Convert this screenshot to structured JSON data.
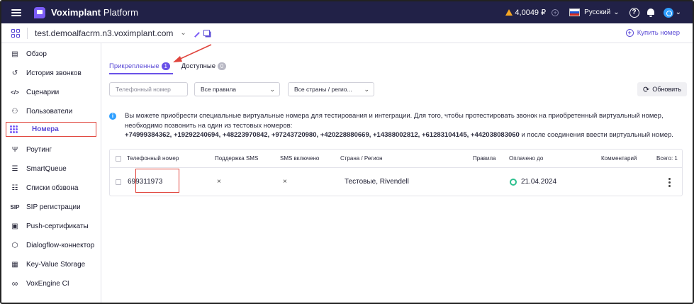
{
  "topbar": {
    "brand_bold": "Voximplant",
    "brand_light": "Platform",
    "balance": "4,0049 ₽",
    "language": "Русский",
    "help_glyph": "?",
    "menu_icon": "hamburger-icon",
    "logo_icon": "voximplant-logo-icon",
    "warning_icon": "warning-icon",
    "notifications_icon": "bell-icon",
    "user_icon": "power-icon"
  },
  "account": {
    "name": "test.demoalfacrm.n3.voximplant.com",
    "buy_label": "Купить номер"
  },
  "sidebar": {
    "items": [
      {
        "label": "Обзор",
        "icon": "dashboard-icon",
        "glyph": "▤"
      },
      {
        "label": "История звонков",
        "icon": "history-icon",
        "glyph": "↺"
      },
      {
        "label": "Сценарии",
        "icon": "code-icon",
        "glyph": "</>"
      },
      {
        "label": "Пользователи",
        "icon": "users-icon",
        "glyph": "⚇"
      },
      {
        "label": "Номера",
        "icon": "dialpad-icon",
        "glyph": "",
        "active": true
      },
      {
        "label": "Роутинг",
        "icon": "routing-icon",
        "glyph": "Ψ"
      },
      {
        "label": "SmartQueue",
        "icon": "queue-icon",
        "glyph": "☰"
      },
      {
        "label": "Списки обзвона",
        "icon": "list-icon",
        "glyph": "☷"
      },
      {
        "label": "SIP регистрации",
        "icon": "sip-icon",
        "glyph": "SIP"
      },
      {
        "label": "Push-сертификаты",
        "icon": "certificate-icon",
        "glyph": "▣"
      },
      {
        "label": "Dialogflow-коннектор",
        "icon": "dialogflow-icon",
        "glyph": "⬡"
      },
      {
        "label": "Key-Value Storage",
        "icon": "storage-icon",
        "glyph": "▦"
      },
      {
        "label": "VoxEngine CI",
        "icon": "infinity-icon",
        "glyph": "∞"
      }
    ]
  },
  "tabs": [
    {
      "label": "Прикрепленные",
      "count": "1",
      "active": true
    },
    {
      "label": "Доступные",
      "count": "0",
      "active": false
    }
  ],
  "filters": {
    "phone_placeholder": "Телефонный номер",
    "rules_value": "Все правила",
    "countries_value": "Все страны / регио...",
    "refresh_label": "Обновить"
  },
  "info": {
    "line1": "Вы можете приобрести специальные виртуальные номера для тестирования и интеграции. Для того, чтобы протестировать звонок на приобретенный виртуальный номер,",
    "line2": "необходимо позвонить на один из тестовых номеров:",
    "numbers": "+74999384362, +19292240694, +48223970842, +97243720980, +420228880669, +14388002812, +61283104145, +442038083060",
    "suffix": " и после соединения ввести виртуальный номер."
  },
  "table": {
    "headers": {
      "phone": "Телефонный номер",
      "sms_support": "Поддержка SMS",
      "sms_enabled": "SMS включено",
      "country": "Страна / Регион",
      "rules": "Правила",
      "paid_until": "Оплачено до",
      "comment": "Комментарий",
      "total": "Всего: 1"
    },
    "rows": [
      {
        "phone": "699311973",
        "sms_support": "×",
        "sms_enabled": "×",
        "country": "Тестовые, Rivendell",
        "rules": "",
        "paid_until": "21.04.2024",
        "comment": ""
      }
    ]
  },
  "colors": {
    "topbar_bg": "#212147",
    "accent": "#6a52e8",
    "highlight": "#e0443c",
    "status_ok": "#2fc08f",
    "info": "#2f9fff"
  }
}
